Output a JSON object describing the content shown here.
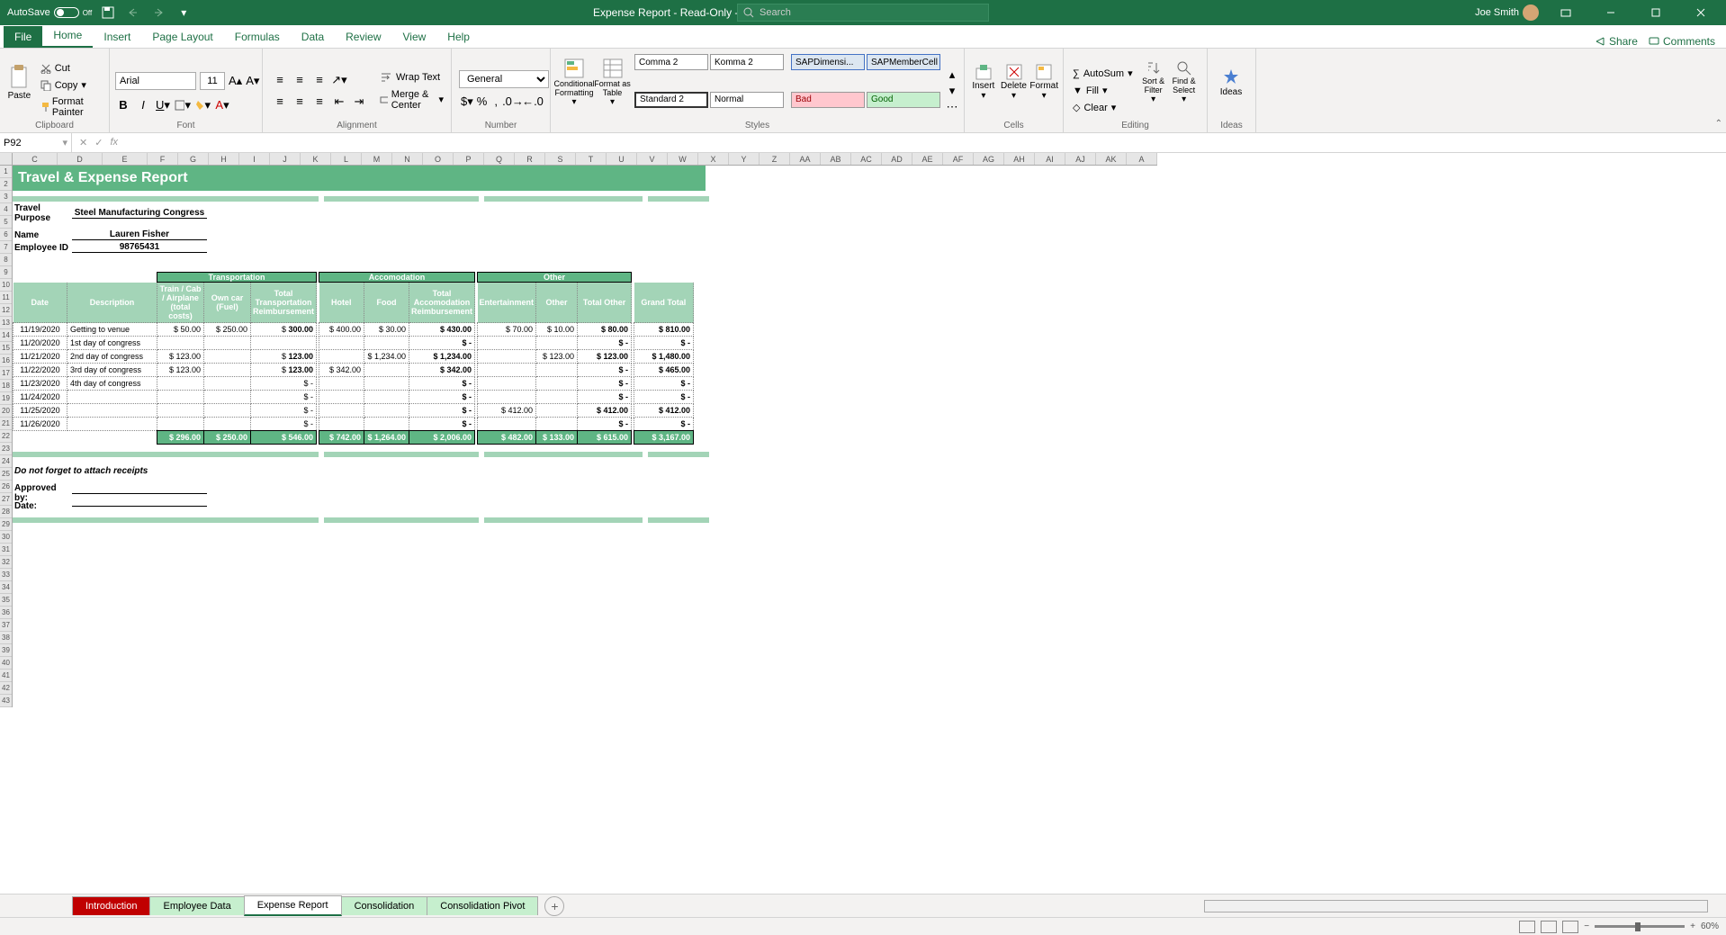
{
  "titlebar": {
    "autosave_label": "AutoSave",
    "autosave_state": "Off",
    "doc_title": "Expense Report - Read-Only - Excel",
    "search_placeholder": "Search",
    "user_name": "Joe Smith"
  },
  "ribbon_tabs": {
    "file": "File",
    "home": "Home",
    "insert": "Insert",
    "page_layout": "Page Layout",
    "formulas": "Formulas",
    "data": "Data",
    "review": "Review",
    "view": "View",
    "help": "Help",
    "share": "Share",
    "comments": "Comments"
  },
  "ribbon": {
    "clipboard": {
      "label": "Clipboard",
      "paste": "Paste",
      "cut": "Cut",
      "copy": "Copy",
      "fp": "Format Painter"
    },
    "font": {
      "label": "Font",
      "name": "Arial",
      "size": "11"
    },
    "alignment": {
      "label": "Alignment",
      "wrap": "Wrap Text",
      "merge": "Merge & Center"
    },
    "number": {
      "label": "Number",
      "format": "General"
    },
    "styles": {
      "label": "Styles",
      "cond": "Conditional Formatting",
      "fat": "Format as Table",
      "comma2": "Comma 2",
      "komma2": "Komma 2",
      "std2": "Standard 2",
      "normal": "Normal",
      "sapd": "SAPDimensi...",
      "sapm": "SAPMemberCell",
      "bad": "Bad",
      "good": "Good"
    },
    "cells": {
      "label": "Cells",
      "insert": "Insert",
      "delete": "Delete",
      "format": "Format"
    },
    "editing": {
      "label": "Editing",
      "autosum": "AutoSum",
      "fill": "Fill",
      "clear": "Clear",
      "sort": "Sort & Filter",
      "find": "Find & Select"
    },
    "ideas": {
      "label": "Ideas",
      "ideas": "Ideas"
    }
  },
  "formula": {
    "name_box": "P92"
  },
  "columns": [
    "C",
    "D",
    "E",
    "F",
    "G",
    "H",
    "I",
    "J",
    "K",
    "L",
    "M",
    "N",
    "O",
    "P",
    "Q",
    "R",
    "S",
    "T",
    "U",
    "V",
    "W",
    "X",
    "Y",
    "Z",
    "AA",
    "AB",
    "AC",
    "AD",
    "AE",
    "AF",
    "AG",
    "AH",
    "AI",
    "AJ",
    "AK",
    "A"
  ],
  "report": {
    "title": "Travel & Expense Report",
    "purpose_label": "Travel Purpose",
    "purpose": "Steel Manufacturing Congress",
    "name_label": "Name",
    "name": "Lauren Fisher",
    "emp_label": "Employee ID",
    "emp_id": "98765431",
    "note": "Do not forget to attach receipts",
    "approved_label": "Approved by:",
    "date_label": "Date:"
  },
  "table": {
    "cat_transport": "Transportation",
    "cat_accom": "Accomodation",
    "cat_other": "Other",
    "col_date": "Date",
    "col_desc": "Description",
    "col_train": "Train / Cab / Airplane (total costs)",
    "col_owncar": "Own car (Fuel)",
    "col_tot_trans": "Total Transportation Reimbursement",
    "col_hotel": "Hotel",
    "col_food": "Food",
    "col_tot_accom": "Total Accomodation Reimbursement",
    "col_ent": "Entertainment",
    "col_other": "Other",
    "col_tot_other": "Total Other",
    "col_grand": "Grand Total",
    "rows": [
      {
        "date": "11/19/2020",
        "desc": "Getting to venue",
        "train": "50.00",
        "own": "250.00",
        "ttrans": "300.00",
        "hotel": "400.00",
        "food": "30.00",
        "taccom": "430.00",
        "ent": "70.00",
        "oth": "10.00",
        "tother": "80.00",
        "grand": "810.00"
      },
      {
        "date": "11/20/2020",
        "desc": "1st day of congress",
        "train": "",
        "own": "",
        "ttrans": "",
        "hotel": "",
        "food": "",
        "taccom": "-",
        "ent": "",
        "oth": "",
        "tother": "-",
        "grand": "-"
      },
      {
        "date": "11/21/2020",
        "desc": "2nd day of congress",
        "train": "123.00",
        "own": "",
        "ttrans": "123.00",
        "hotel": "",
        "food": "1,234.00",
        "taccom": "1,234.00",
        "ent": "",
        "oth": "123.00",
        "tother": "123.00",
        "grand": "1,480.00"
      },
      {
        "date": "11/22/2020",
        "desc": "3rd day of congress",
        "train": "123.00",
        "own": "",
        "ttrans": "123.00",
        "hotel": "342.00",
        "food": "",
        "taccom": "342.00",
        "ent": "",
        "oth": "",
        "tother": "-",
        "grand": "465.00"
      },
      {
        "date": "11/23/2020",
        "desc": "4th day of congress",
        "train": "",
        "own": "",
        "ttrans": "-",
        "hotel": "",
        "food": "",
        "taccom": "-",
        "ent": "",
        "oth": "",
        "tother": "-",
        "grand": "-"
      },
      {
        "date": "11/24/2020",
        "desc": "",
        "train": "",
        "own": "",
        "ttrans": "-",
        "hotel": "",
        "food": "",
        "taccom": "-",
        "ent": "",
        "oth": "",
        "tother": "-",
        "grand": "-"
      },
      {
        "date": "11/25/2020",
        "desc": "",
        "train": "",
        "own": "",
        "ttrans": "-",
        "hotel": "",
        "food": "",
        "taccom": "-",
        "ent": "412.00",
        "oth": "",
        "tother": "412.00",
        "grand": "412.00"
      },
      {
        "date": "11/26/2020",
        "desc": "",
        "train": "",
        "own": "",
        "ttrans": "-",
        "hotel": "",
        "food": "",
        "taccom": "-",
        "ent": "",
        "oth": "",
        "tother": "-",
        "grand": "-"
      }
    ],
    "totals": {
      "train": "296.00",
      "own": "250.00",
      "ttrans": "546.00",
      "hotel": "742.00",
      "food": "1,264.00",
      "taccom": "2,006.00",
      "ent": "482.00",
      "oth": "133.00",
      "tother": "615.00",
      "grand": "3,167.00"
    }
  },
  "sheets": {
    "intro": "Introduction",
    "emp": "Employee Data",
    "expense": "Expense Report",
    "consol": "Consolidation",
    "pivot": "Consolidation Pivot"
  },
  "status": {
    "zoom": "60%"
  }
}
